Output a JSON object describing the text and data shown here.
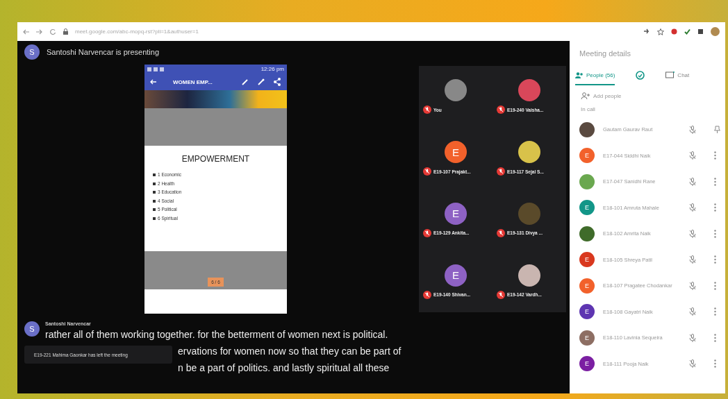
{
  "browser": {
    "url": "meet.google.com/abc-mopq-rst?pli=1&authuser=1"
  },
  "presenter": {
    "initial": "S",
    "text": "Santoshi Narvencar is presenting"
  },
  "phone": {
    "time": "12:26 pm",
    "title": "WOMEN EMP...",
    "slide_title": "EMPOWERMENT",
    "slide_items": [
      "1 Economic",
      "2 Health",
      "3 Education",
      "4 Social",
      "5 Political",
      "6 Spiritual"
    ],
    "page": "6 / 6"
  },
  "tiles": [
    {
      "name": "You",
      "avatar": {
        "kind": "photo",
        "color": "#888888"
      },
      "muted": true
    },
    {
      "name": "E19-240 Vaisha...",
      "avatar": {
        "kind": "photo",
        "color": "#d9475a"
      },
      "muted": true
    },
    {
      "name": "E19-107 Prajakt...",
      "avatar": {
        "kind": "letter",
        "initial": "E",
        "color": "#f2612b"
      },
      "muted": true
    },
    {
      "name": "E19-117 Sejal S...",
      "avatar": {
        "kind": "photo",
        "color": "#d8c24a"
      },
      "muted": true
    },
    {
      "name": "E19-129 Ankita...",
      "avatar": {
        "kind": "letter",
        "initial": "E",
        "color": "#8e62c4"
      },
      "muted": true
    },
    {
      "name": "E19-131 Divya ...",
      "avatar": {
        "kind": "photo",
        "color": "#5a4a2a"
      },
      "muted": true
    },
    {
      "name": "E19-140 Shivan...",
      "avatar": {
        "kind": "letter",
        "initial": "E",
        "color": "#8e62c4"
      },
      "muted": true
    },
    {
      "name": "E19-142 Vardh...",
      "avatar": {
        "kind": "photo",
        "color": "#c9b5b0"
      },
      "muted": true
    }
  ],
  "panel": {
    "title": "Meeting details",
    "tabs": [
      {
        "kind": "people",
        "label": "People (56)",
        "selected": true
      },
      {
        "kind": "activities",
        "selected": false
      },
      {
        "kind": "chat",
        "label": "Chat",
        "selected": false
      }
    ],
    "add_people": "Add people",
    "section_label": "In call",
    "participants": [
      {
        "name": "Gautam Gaurav Raut",
        "avatar": {
          "kind": "photo",
          "color": "#5a4a40"
        },
        "action": {
          "kind": "pin"
        }
      },
      {
        "name": "E17-044 Siddhi Naik",
        "avatar": {
          "kind": "letter",
          "initial": "E",
          "color": "#f2612b"
        },
        "action": {
          "kind": "more"
        }
      },
      {
        "name": "E17-047 Sanidhi Rane",
        "avatar": {
          "kind": "photo",
          "color": "#6aa84f"
        },
        "action": {
          "kind": "more"
        }
      },
      {
        "name": "E18-101 Amruta Mahale",
        "avatar": {
          "kind": "letter",
          "initial": "E",
          "color": "#129688"
        },
        "action": {
          "kind": "more"
        }
      },
      {
        "name": "E18-102 Amrita Naik",
        "avatar": {
          "kind": "photo",
          "color": "#3f6b2a"
        },
        "action": {
          "kind": "more"
        }
      },
      {
        "name": "E18-105 Shreya Patil",
        "avatar": {
          "kind": "letter",
          "initial": "E",
          "color": "#d9381e"
        },
        "action": {
          "kind": "more"
        }
      },
      {
        "name": "E18-107 Pragatee Chodankar",
        "avatar": {
          "kind": "letter",
          "initial": "E",
          "color": "#f2612b"
        },
        "action": {
          "kind": "more"
        }
      },
      {
        "name": "E18-108 Gayatri Naik",
        "avatar": {
          "kind": "letter",
          "initial": "E",
          "color": "#5e35b1"
        },
        "action": {
          "kind": "more"
        }
      },
      {
        "name": "E18-110 Lavinia Sequeira",
        "avatar": {
          "kind": "letter",
          "initial": "E",
          "color": "#8d6e63"
        },
        "action": {
          "kind": "more"
        }
      },
      {
        "name": "E18-111 Pooja Naik",
        "avatar": {
          "kind": "letter",
          "initial": "E",
          "color": "#7b1fa2"
        },
        "action": {
          "kind": "more"
        }
      }
    ]
  },
  "caption": {
    "initial": "S",
    "speaker": "Santoshi Narvencar",
    "lines": [
      "rather all of them working together. for the betterment of women next is political.",
      "ervations for women now so that they can be part of",
      "n be a part of politics. and lastly spiritual all these"
    ]
  },
  "toast": {
    "text": "E19-221 Mahima Gaonkar has left the meeting"
  }
}
